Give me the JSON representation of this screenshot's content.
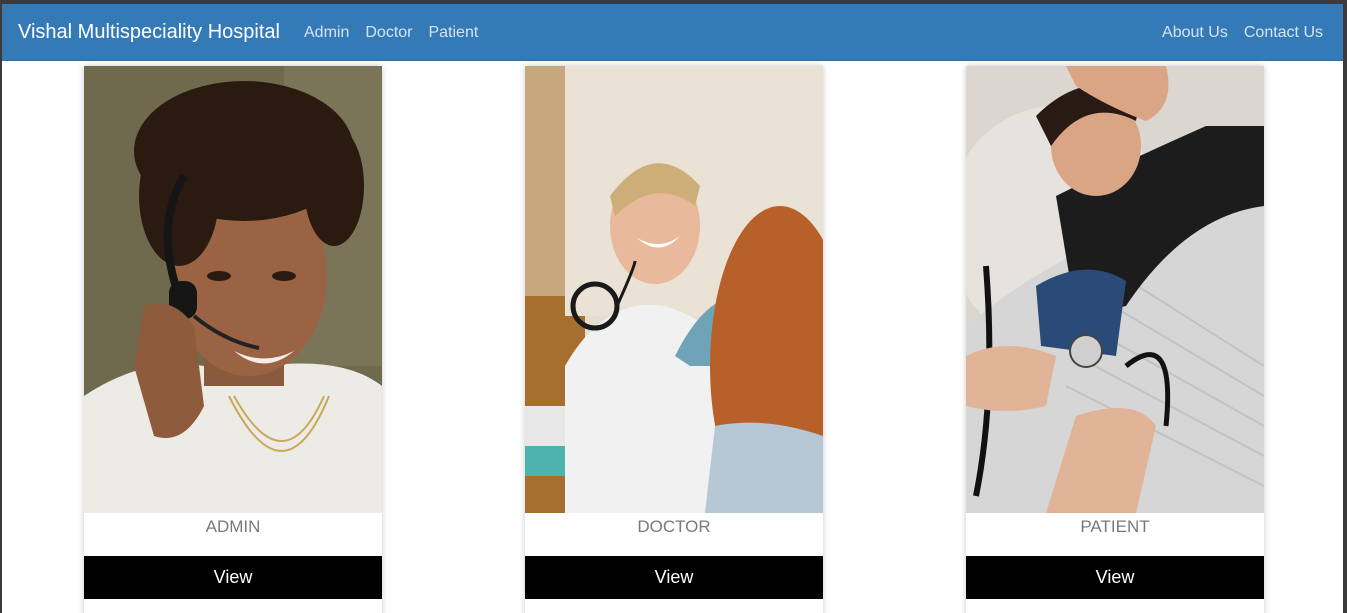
{
  "navbar": {
    "brand": "Vishal Multispeciality Hospital",
    "left_links": [
      "Admin",
      "Doctor",
      "Patient"
    ],
    "right_links": [
      "About Us",
      "Contact Us"
    ],
    "bg_color": "#337ab7"
  },
  "cards": [
    {
      "title": "ADMIN",
      "button": "View",
      "image": "admin-woman-headset-photo"
    },
    {
      "title": "DOCTOR",
      "button": "View",
      "image": "doctor-with-stethoscope-photo"
    },
    {
      "title": "PATIENT",
      "button": "View",
      "image": "patient-blood-pressure-photo"
    }
  ]
}
